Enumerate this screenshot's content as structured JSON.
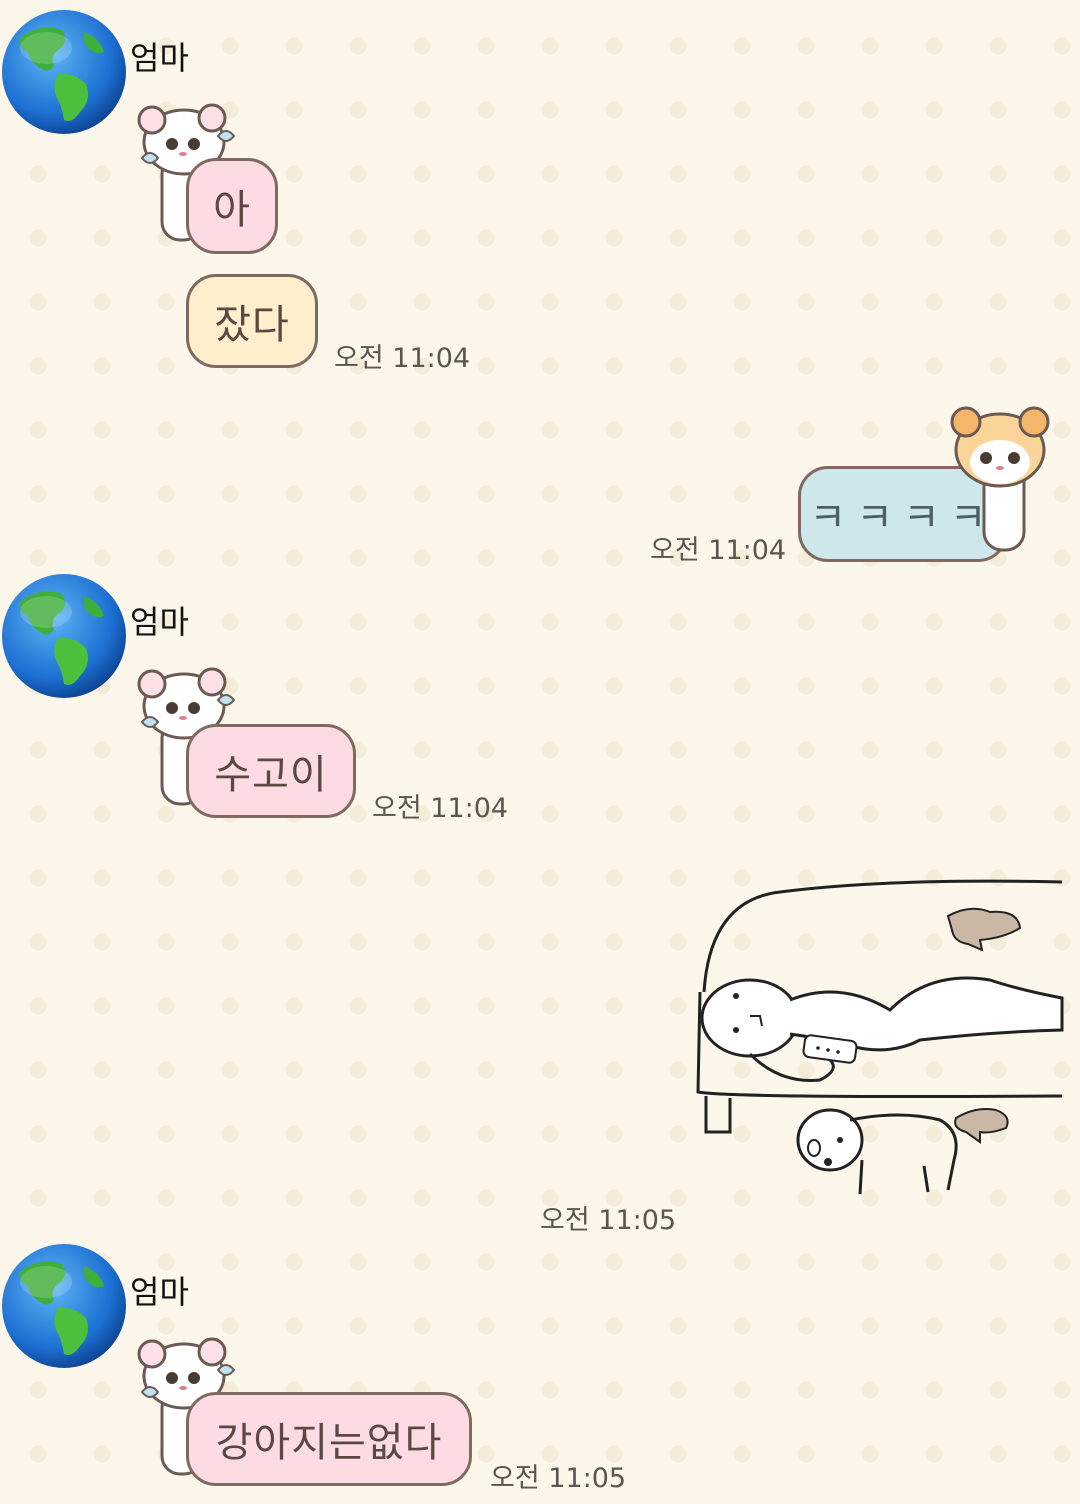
{
  "messages": [
    {
      "sender": "엄마",
      "lines": [
        "아",
        "잤다"
      ],
      "time": "오전 11:04"
    },
    {
      "sender": "me",
      "text": "ㅋㅋㅋㅋ",
      "time": "오전 11:04"
    },
    {
      "sender": "엄마",
      "text": "수고이",
      "time": "오전 11:04"
    },
    {
      "sender": "me",
      "photo": "sketch-person-on-sofa-with-dog",
      "time": "오전 11:05"
    },
    {
      "sender": "엄마",
      "text": "강아지는없다",
      "time": "오전 11:05"
    }
  ],
  "colors": {
    "background": "#fcf7ea",
    "bubble_pink": "#fddbe3",
    "bubble_yellow": "#fdefcc",
    "bubble_blue": "#cde7ea",
    "bubble_border": "#7f6a62"
  },
  "icons": {
    "avatar": "earth-globe-icon",
    "bubble_decoration": "hamster-sticker-icon"
  }
}
